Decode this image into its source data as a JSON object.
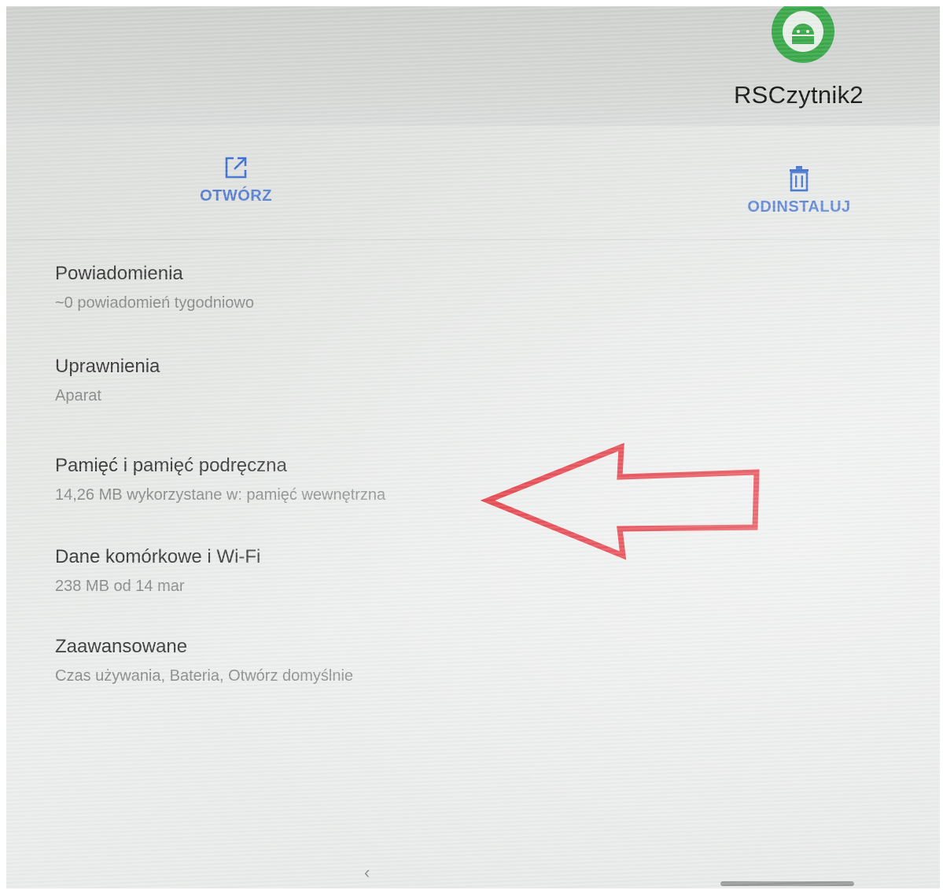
{
  "app": {
    "name": "RSCzytnik2",
    "icon": "android-icon",
    "icon_color": "#3aa84a"
  },
  "actions": {
    "open_label": "OTWÓRZ",
    "open_icon": "open-external-icon",
    "uninstall_label": "ODINSTALUJ",
    "uninstall_icon": "trash-icon",
    "accent_color": "#3f6fcf"
  },
  "settings": {
    "items": [
      {
        "title": "Powiadomienia",
        "subtitle": "~0 powiadomień tygodniowo"
      },
      {
        "title": "Uprawnienia",
        "subtitle": "Aparat"
      },
      {
        "title": "Pamięć i pamięć podręczna",
        "subtitle": "14,26 MB wykorzystane w: pamięć wewnętrzna"
      },
      {
        "title": "Dane komórkowe i Wi-Fi",
        "subtitle": "238 MB od 14 mar"
      },
      {
        "title": "Zaawansowane",
        "subtitle": "Czas używania, Bateria, Otwórz domyślnie"
      }
    ]
  },
  "annotation": {
    "arrow_color": "#e0242e",
    "points_to": "Pamięć i pamięć podręczna"
  },
  "navigation": {
    "back_glyph": "‹"
  }
}
